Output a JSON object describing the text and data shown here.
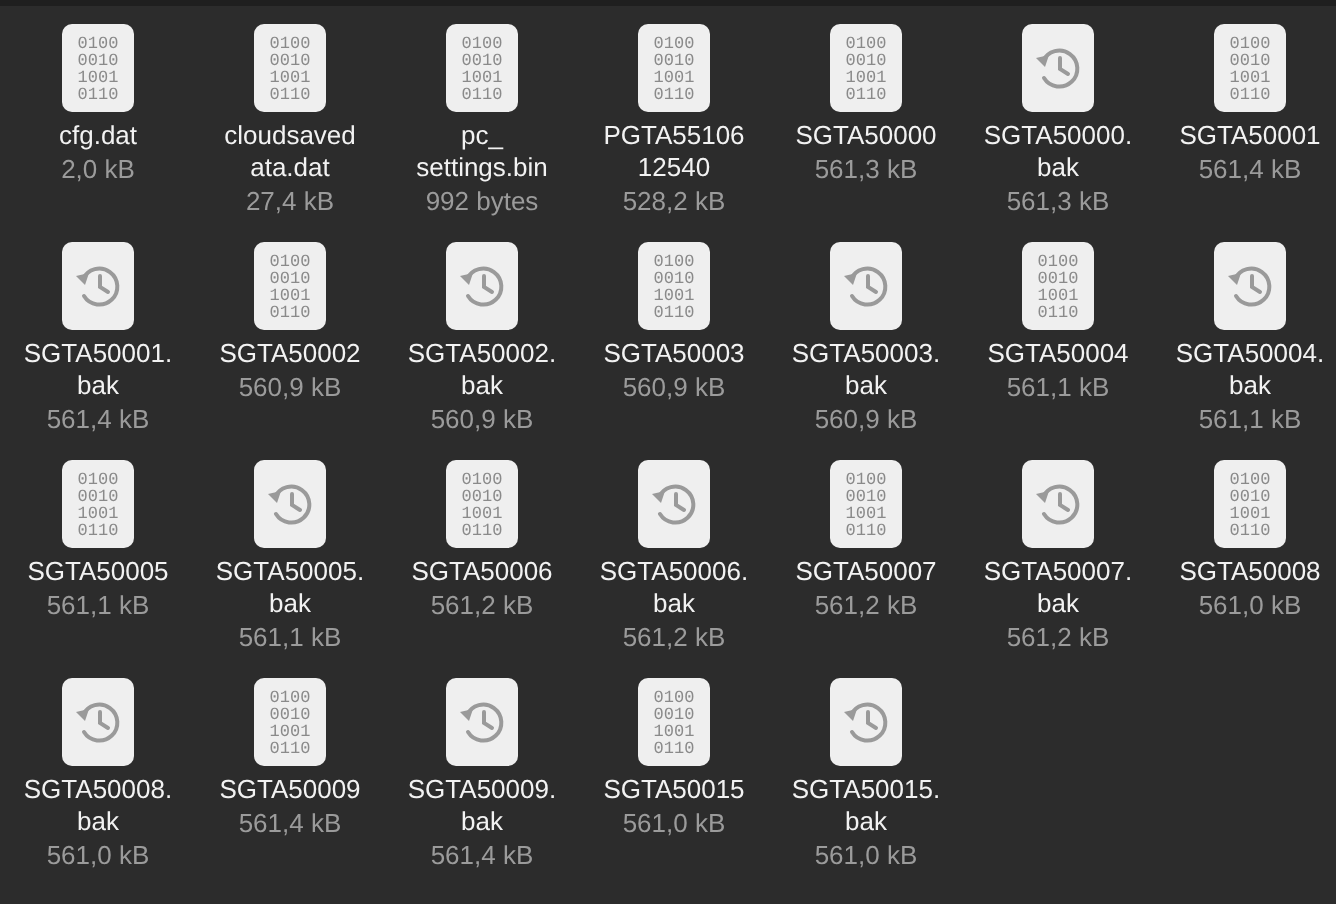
{
  "files": [
    {
      "kind": "binary",
      "icon_lines": [
        "0100",
        "0010",
        "1001",
        "0110"
      ],
      "name_lines": [
        "cfg.dat"
      ],
      "size": "2,0 kB"
    },
    {
      "kind": "binary",
      "icon_lines": [
        "0100",
        "0010",
        "1001",
        "0110"
      ],
      "name_lines": [
        "cloudsaved",
        "ata.dat"
      ],
      "size": "27,4 kB"
    },
    {
      "kind": "binary",
      "icon_lines": [
        "0100",
        "0010",
        "1001",
        "0110"
      ],
      "name_lines": [
        "pc_",
        "settings.bin"
      ],
      "size": "992 bytes"
    },
    {
      "kind": "binary",
      "icon_lines": [
        "0100",
        "0010",
        "1001",
        "0110"
      ],
      "name_lines": [
        "PGTA55106",
        "12540"
      ],
      "size": "528,2 kB"
    },
    {
      "kind": "binary",
      "icon_lines": [
        "0100",
        "0010",
        "1001",
        "0110"
      ],
      "name_lines": [
        "SGTA50000"
      ],
      "size": "561,3 kB"
    },
    {
      "kind": "backup",
      "name_lines": [
        "SGTA50000.",
        "bak"
      ],
      "size": "561,3 kB"
    },
    {
      "kind": "binary",
      "icon_lines": [
        "0100",
        "0010",
        "1001",
        "0110"
      ],
      "name_lines": [
        "SGTA50001"
      ],
      "size": "561,4 kB"
    },
    {
      "kind": "backup",
      "name_lines": [
        "SGTA50001.",
        "bak"
      ],
      "size": "561,4 kB"
    },
    {
      "kind": "binary",
      "icon_lines": [
        "0100",
        "0010",
        "1001",
        "0110"
      ],
      "name_lines": [
        "SGTA50002"
      ],
      "size": "560,9 kB"
    },
    {
      "kind": "backup",
      "name_lines": [
        "SGTA50002.",
        "bak"
      ],
      "size": "560,9 kB"
    },
    {
      "kind": "binary",
      "icon_lines": [
        "0100",
        "0010",
        "1001",
        "0110"
      ],
      "name_lines": [
        "SGTA50003"
      ],
      "size": "560,9 kB"
    },
    {
      "kind": "backup",
      "name_lines": [
        "SGTA50003.",
        "bak"
      ],
      "size": "560,9 kB"
    },
    {
      "kind": "binary",
      "icon_lines": [
        "0100",
        "0010",
        "1001",
        "0110"
      ],
      "name_lines": [
        "SGTA50004"
      ],
      "size": "561,1 kB"
    },
    {
      "kind": "backup",
      "name_lines": [
        "SGTA50004.",
        "bak"
      ],
      "size": "561,1 kB"
    },
    {
      "kind": "binary",
      "icon_lines": [
        "0100",
        "0010",
        "1001",
        "0110"
      ],
      "name_lines": [
        "SGTA50005"
      ],
      "size": "561,1 kB"
    },
    {
      "kind": "backup",
      "name_lines": [
        "SGTA50005.",
        "bak"
      ],
      "size": "561,1 kB"
    },
    {
      "kind": "binary",
      "icon_lines": [
        "0100",
        "0010",
        "1001",
        "0110"
      ],
      "name_lines": [
        "SGTA50006"
      ],
      "size": "561,2 kB"
    },
    {
      "kind": "backup",
      "name_lines": [
        "SGTA50006.",
        "bak"
      ],
      "size": "561,2 kB"
    },
    {
      "kind": "binary",
      "icon_lines": [
        "0100",
        "0010",
        "1001",
        "0110"
      ],
      "name_lines": [
        "SGTA50007"
      ],
      "size": "561,2 kB"
    },
    {
      "kind": "backup",
      "name_lines": [
        "SGTA50007.",
        "bak"
      ],
      "size": "561,2 kB"
    },
    {
      "kind": "binary",
      "icon_lines": [
        "0100",
        "0010",
        "1001",
        "0110"
      ],
      "name_lines": [
        "SGTA50008"
      ],
      "size": "561,0 kB"
    },
    {
      "kind": "backup",
      "name_lines": [
        "SGTA50008.",
        "bak"
      ],
      "size": "561,0 kB"
    },
    {
      "kind": "binary",
      "icon_lines": [
        "0100",
        "0010",
        "1001",
        "0110"
      ],
      "name_lines": [
        "SGTA50009"
      ],
      "size": "561,4 kB"
    },
    {
      "kind": "backup",
      "name_lines": [
        "SGTA50009.",
        "bak"
      ],
      "size": "561,4 kB"
    },
    {
      "kind": "binary",
      "icon_lines": [
        "0100",
        "0010",
        "1001",
        "0110"
      ],
      "name_lines": [
        "SGTA50015"
      ],
      "size": "561,0 kB"
    },
    {
      "kind": "backup",
      "name_lines": [
        "SGTA50015.",
        "bak"
      ],
      "size": "561,0 kB"
    }
  ]
}
